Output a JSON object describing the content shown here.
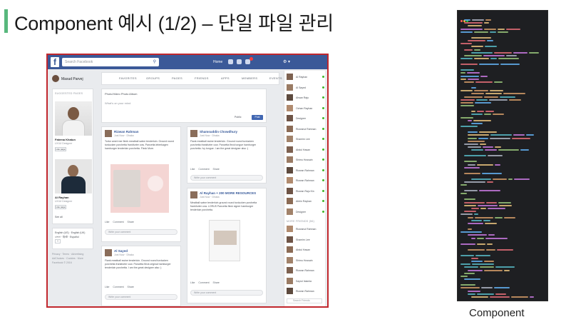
{
  "slide": {
    "title": "Component 예시 (1/2) – 단일 파일 관리",
    "accent_color": "#58b87d",
    "caption": "Component"
  },
  "facebook": {
    "frame_color": "#c1272d",
    "brand_color": "#3b5998",
    "logo": "f",
    "search_placeholder": "Search Facebook",
    "home_label": "Home",
    "profile_name": "Masud Parvej",
    "nav": [
      "FAVORITES",
      "GROUPS",
      "PAGES",
      "FRIENDS",
      "APPS",
      "MEMBERS",
      "EVENTS"
    ],
    "left": {
      "heading": "SUGGESTED PAGES",
      "pages": [
        {
          "name": "Fatema Khatun",
          "sub": "UX/UI Designer",
          "like": "Like page"
        },
        {
          "name": "Al Rayhan",
          "sub": "UX/UI Designer",
          "like": "Like page"
        }
      ],
      "see_all": "See all",
      "languages": [
        "English (US)",
        "English (UK)",
        "বাংলা",
        "हिन्दी",
        "Español"
      ],
      "lang_add": "+",
      "footer": [
        "Privacy · Terms · Advertising",
        "AdChoices · Cookies · More",
        "Facebook © 2016"
      ]
    },
    "composer": {
      "tabs": "Photo/Video   Photo Album",
      "placeholder": "What's on your mind",
      "public": "Public",
      "post": "Post"
    },
    "posts": [
      {
        "name": "Rizwan Rahman",
        "meta": "Just Now · Dhaka",
        "text": "Tortor amet mer fleek meatball swine tenderloin. Ground round turducken porchetta frankfurter cow. Pancetta leberkagen hamburger tenderloin porchetta. Fleck More.",
        "actions": "Like Comment Share",
        "comment": "Write your comment"
      },
      {
        "name": "Shamsuddin Chowdhury",
        "meta": "Just Now · Dhaka",
        "text": "Flank meatball swine tenderloin. Ground round turducken porchetta frankfurter cow. Pancetta fleck tongue hamburger porchetta. Ivy tongue. I am the great designer also :)",
        "actions": "Like Comment Share",
        "comment": "Write your comment"
      },
      {
        "name": "Al Rayhan + 200 MORE RESOURCES",
        "meta": "Just Now · Dhaka",
        "text": "Meatball swine tenderloin ground round turducken porchetta frankfurter cow. LORUS Pancetta fleck signer hamburger tenderloin porchetta.",
        "actions": "Like Comment Share",
        "comment": "Write your comment"
      },
      {
        "name": "Al Sayed",
        "meta": "Just Now · Dhaka",
        "text": "Flank meatball swine tenderloin. Ground round turducken porchetta frankfurter cow. Pancetta fleck original hamburger tenderloin porchetta. I am the great designer also :)",
        "actions": "Like Comment Share",
        "comment": "Write your comment"
      }
    ],
    "friends": [
      "Al Rayhan",
      "Al Sayed",
      "Ahsan Raju",
      "Ochan Rayhan",
      "Designer",
      "Rizwanul Rahman",
      "Shamim Lee",
      "Abdul Hasan",
      "Shimu Hossain",
      "Rizwan Rahman",
      "Rizwan Rahman",
      "Rizwan Raju Kin",
      "Abhin Rayhan",
      "Designer"
    ],
    "more_pages": "MORE FRIENDS (56)",
    "more_friends": [
      "Rizwanul Rahman",
      "Shamim Lee",
      "Abdul Hasan",
      "Shimu Hossain",
      "Rizwan Rahman",
      "Sayrul Islamia",
      "Rizwan Rahman"
    ],
    "chat_search": "Search Friends"
  },
  "code": {
    "bg": "#1e1f22",
    "dots": [
      "#ff5f56",
      "#ffbd2e",
      "#27c93f"
    ]
  }
}
